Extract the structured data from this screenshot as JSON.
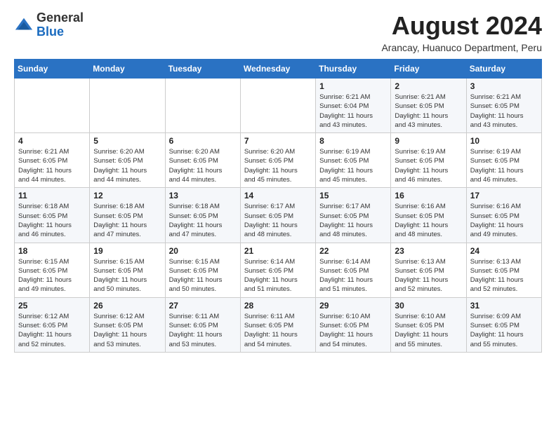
{
  "header": {
    "logo": {
      "line1": "General",
      "line2": "Blue"
    },
    "title": "August 2024",
    "location": "Arancay, Huanuco Department, Peru"
  },
  "weekdays": [
    "Sunday",
    "Monday",
    "Tuesday",
    "Wednesday",
    "Thursday",
    "Friday",
    "Saturday"
  ],
  "weeks": [
    {
      "days": [
        {
          "num": "",
          "info": ""
        },
        {
          "num": "",
          "info": ""
        },
        {
          "num": "",
          "info": ""
        },
        {
          "num": "",
          "info": ""
        },
        {
          "num": "1",
          "info": "Sunrise: 6:21 AM\nSunset: 6:04 PM\nDaylight: 11 hours\nand 43 minutes."
        },
        {
          "num": "2",
          "info": "Sunrise: 6:21 AM\nSunset: 6:05 PM\nDaylight: 11 hours\nand 43 minutes."
        },
        {
          "num": "3",
          "info": "Sunrise: 6:21 AM\nSunset: 6:05 PM\nDaylight: 11 hours\nand 43 minutes."
        }
      ]
    },
    {
      "days": [
        {
          "num": "4",
          "info": "Sunrise: 6:21 AM\nSunset: 6:05 PM\nDaylight: 11 hours\nand 44 minutes."
        },
        {
          "num": "5",
          "info": "Sunrise: 6:20 AM\nSunset: 6:05 PM\nDaylight: 11 hours\nand 44 minutes."
        },
        {
          "num": "6",
          "info": "Sunrise: 6:20 AM\nSunset: 6:05 PM\nDaylight: 11 hours\nand 44 minutes."
        },
        {
          "num": "7",
          "info": "Sunrise: 6:20 AM\nSunset: 6:05 PM\nDaylight: 11 hours\nand 45 minutes."
        },
        {
          "num": "8",
          "info": "Sunrise: 6:19 AM\nSunset: 6:05 PM\nDaylight: 11 hours\nand 45 minutes."
        },
        {
          "num": "9",
          "info": "Sunrise: 6:19 AM\nSunset: 6:05 PM\nDaylight: 11 hours\nand 46 minutes."
        },
        {
          "num": "10",
          "info": "Sunrise: 6:19 AM\nSunset: 6:05 PM\nDaylight: 11 hours\nand 46 minutes."
        }
      ]
    },
    {
      "days": [
        {
          "num": "11",
          "info": "Sunrise: 6:18 AM\nSunset: 6:05 PM\nDaylight: 11 hours\nand 46 minutes."
        },
        {
          "num": "12",
          "info": "Sunrise: 6:18 AM\nSunset: 6:05 PM\nDaylight: 11 hours\nand 47 minutes."
        },
        {
          "num": "13",
          "info": "Sunrise: 6:18 AM\nSunset: 6:05 PM\nDaylight: 11 hours\nand 47 minutes."
        },
        {
          "num": "14",
          "info": "Sunrise: 6:17 AM\nSunset: 6:05 PM\nDaylight: 11 hours\nand 48 minutes."
        },
        {
          "num": "15",
          "info": "Sunrise: 6:17 AM\nSunset: 6:05 PM\nDaylight: 11 hours\nand 48 minutes."
        },
        {
          "num": "16",
          "info": "Sunrise: 6:16 AM\nSunset: 6:05 PM\nDaylight: 11 hours\nand 48 minutes."
        },
        {
          "num": "17",
          "info": "Sunrise: 6:16 AM\nSunset: 6:05 PM\nDaylight: 11 hours\nand 49 minutes."
        }
      ]
    },
    {
      "days": [
        {
          "num": "18",
          "info": "Sunrise: 6:15 AM\nSunset: 6:05 PM\nDaylight: 11 hours\nand 49 minutes."
        },
        {
          "num": "19",
          "info": "Sunrise: 6:15 AM\nSunset: 6:05 PM\nDaylight: 11 hours\nand 50 minutes."
        },
        {
          "num": "20",
          "info": "Sunrise: 6:15 AM\nSunset: 6:05 PM\nDaylight: 11 hours\nand 50 minutes."
        },
        {
          "num": "21",
          "info": "Sunrise: 6:14 AM\nSunset: 6:05 PM\nDaylight: 11 hours\nand 51 minutes."
        },
        {
          "num": "22",
          "info": "Sunrise: 6:14 AM\nSunset: 6:05 PM\nDaylight: 11 hours\nand 51 minutes."
        },
        {
          "num": "23",
          "info": "Sunrise: 6:13 AM\nSunset: 6:05 PM\nDaylight: 11 hours\nand 52 minutes."
        },
        {
          "num": "24",
          "info": "Sunrise: 6:13 AM\nSunset: 6:05 PM\nDaylight: 11 hours\nand 52 minutes."
        }
      ]
    },
    {
      "days": [
        {
          "num": "25",
          "info": "Sunrise: 6:12 AM\nSunset: 6:05 PM\nDaylight: 11 hours\nand 52 minutes."
        },
        {
          "num": "26",
          "info": "Sunrise: 6:12 AM\nSunset: 6:05 PM\nDaylight: 11 hours\nand 53 minutes."
        },
        {
          "num": "27",
          "info": "Sunrise: 6:11 AM\nSunset: 6:05 PM\nDaylight: 11 hours\nand 53 minutes."
        },
        {
          "num": "28",
          "info": "Sunrise: 6:11 AM\nSunset: 6:05 PM\nDaylight: 11 hours\nand 54 minutes."
        },
        {
          "num": "29",
          "info": "Sunrise: 6:10 AM\nSunset: 6:05 PM\nDaylight: 11 hours\nand 54 minutes."
        },
        {
          "num": "30",
          "info": "Sunrise: 6:10 AM\nSunset: 6:05 PM\nDaylight: 11 hours\nand 55 minutes."
        },
        {
          "num": "31",
          "info": "Sunrise: 6:09 AM\nSunset: 6:05 PM\nDaylight: 11 hours\nand 55 minutes."
        }
      ]
    }
  ]
}
